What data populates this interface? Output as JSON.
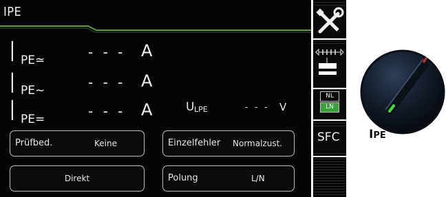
{
  "screen": {
    "title": "IPE",
    "measurements": [
      {
        "symbol": "I",
        "subscript": "PE≃",
        "value": "- - -",
        "unit": "A"
      },
      {
        "symbol": "I",
        "subscript": "PE~",
        "value": "- - -",
        "unit": "A"
      },
      {
        "symbol": "I",
        "subscript": "PE=",
        "value": "- - -",
        "unit": "A"
      }
    ],
    "voltage": {
      "symbol": "U",
      "subscript": "LPE",
      "value": "- - -",
      "unit": "V"
    }
  },
  "params": [
    {
      "label": "Prüfbed.",
      "value": "Keine"
    },
    {
      "label": "Einzelfehler",
      "value": "Normalzust."
    },
    {
      "label": "",
      "value": "Direkt"
    },
    {
      "label": "Polung",
      "value": "L/N"
    }
  ],
  "sidebar": {
    "nl_label": "NL",
    "ln_label": "LN",
    "sfc_label": "SFC",
    "accent_color": "#3ca03c"
  },
  "knob": {
    "label_big": "I",
    "label_small": "PE"
  }
}
